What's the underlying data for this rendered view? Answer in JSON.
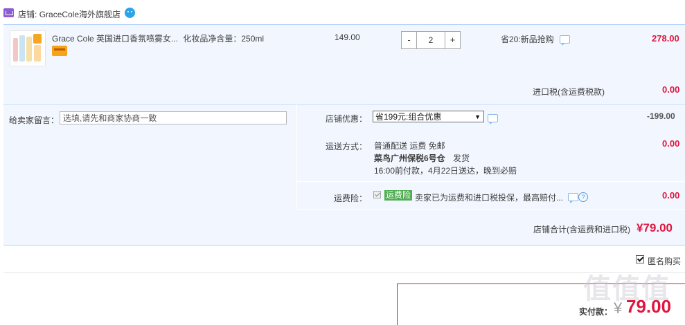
{
  "shop": {
    "label": "店铺:",
    "name": "GraceCole海外旗舰店"
  },
  "item": {
    "name": "Grace Cole 英国进口香氛喷雾女...",
    "sku": "化妆品净含量：250ml",
    "unit_price": "149.00",
    "qty_minus": "-",
    "quantity": "2",
    "qty_plus": "+",
    "promo": "省20:新品抢购",
    "subtotal": "278.00"
  },
  "tax": {
    "label": "进口税(含运费税款)",
    "amount": "0.00"
  },
  "memo": {
    "label": "给卖家留言：",
    "placeholder": "选填,请先和商家协商一致"
  },
  "discount": {
    "label": "店铺优惠：",
    "selected": "省199元:组合优惠",
    "amount": "-199.00"
  },
  "shipping": {
    "label": "运送方式：",
    "method": "普通配送 运费 免邮",
    "warehouse": "菜鸟广州保税6号仓",
    "dispatch": "发货",
    "eta": "16:00前付款，4月22日送达，晚到必赔",
    "amount": "0.00"
  },
  "insurance": {
    "label": "运费险：",
    "badge": "运费险",
    "desc": "卖家已为运费和进口税投保，最高赔付...",
    "help": "?",
    "amount": "0.00"
  },
  "shop_total": {
    "label": "店铺合计(含运费和进口税)",
    "amount": "¥79.00"
  },
  "anonymous": {
    "label": "匿名购买",
    "checked": true
  },
  "payment": {
    "label": "实付款：",
    "currency": "¥",
    "amount": "79.00"
  },
  "watermark": "值值值",
  "colors": {
    "accent_red": "#e0153e",
    "panel_bg": "#f2f7ff",
    "panel_border": "#b2d1ff",
    "insurance_green": "#4fae52"
  }
}
